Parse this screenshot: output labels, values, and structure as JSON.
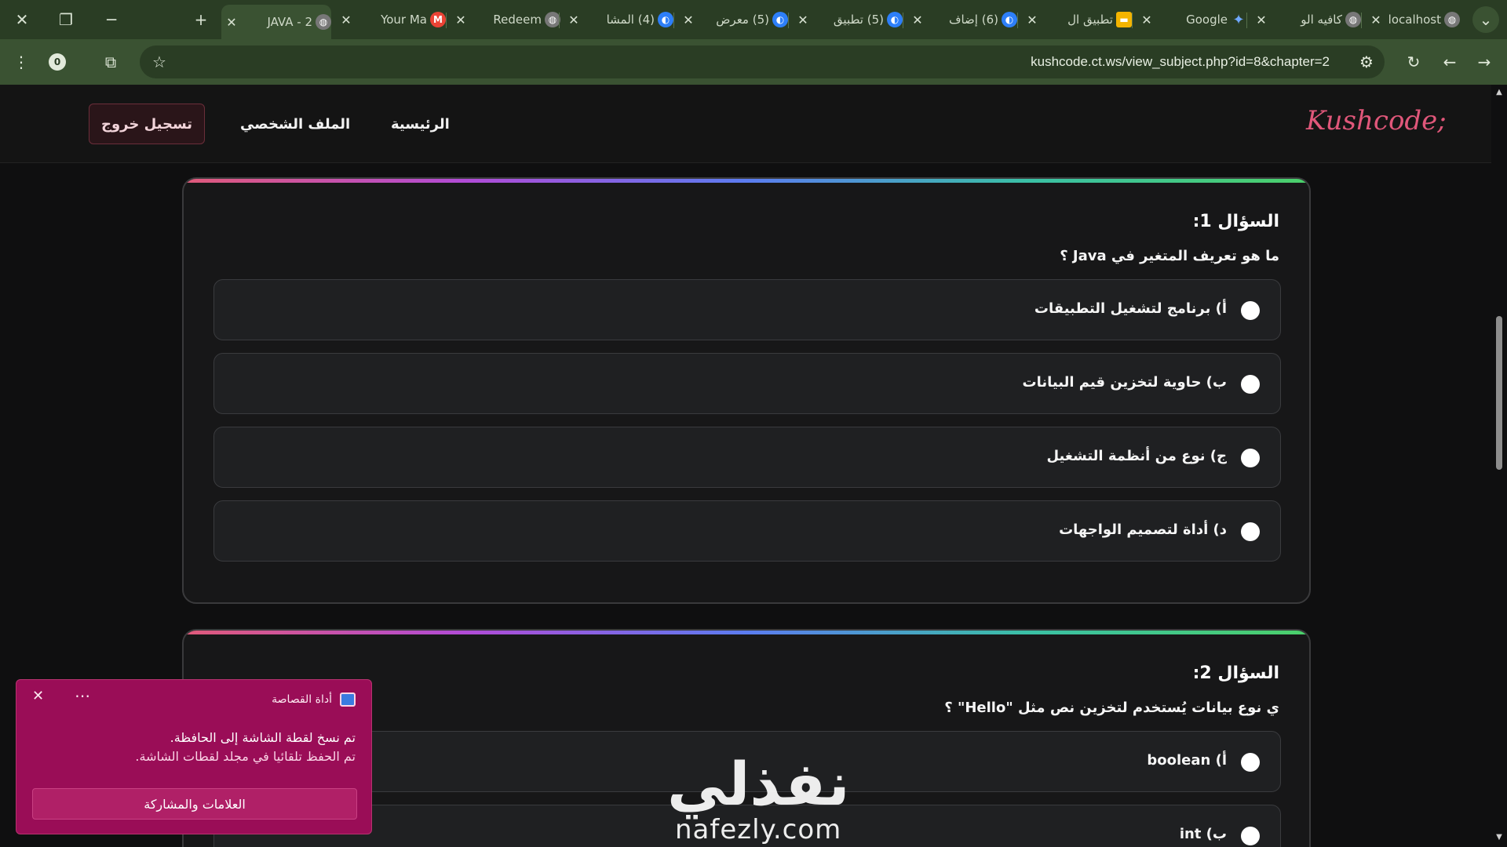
{
  "browser": {
    "tabs": [
      {
        "title": "localhost",
        "icon": "globe-icon"
      },
      {
        "title": "كافيه الو",
        "icon": "globe-icon"
      },
      {
        "title": "Google",
        "icon": "gemini-icon"
      },
      {
        "title": "تطبيق ال",
        "icon": "slides-icon"
      },
      {
        "title": "(6) إضاف",
        "icon": "app-icon"
      },
      {
        "title": "(5) تطبيق",
        "icon": "app-icon"
      },
      {
        "title": "(5) معرض",
        "icon": "app-icon"
      },
      {
        "title": "(4) المشا",
        "icon": "app-icon"
      },
      {
        "title": "Redeem",
        "icon": "globe-icon"
      },
      {
        "title": "Your Ma",
        "icon": "gmail-icon"
      },
      {
        "title": "JAVA - 2",
        "icon": "globe-icon",
        "active": true
      }
    ],
    "url": "kushcode.ct.ws/view_subject.php?id=8&chapter=2",
    "extension_badge": "0"
  },
  "site": {
    "logo": "Kushcode;",
    "nav": {
      "home": "الرئيسية",
      "profile": "الملف الشخصي",
      "logout": "تسجيل خروج"
    }
  },
  "questions": [
    {
      "title": "السؤال 1:",
      "text": "ما هو تعريف المتغير في Java ؟",
      "options": [
        "أ) برنامج لتشغيل التطبيقات",
        "ب) حاوية لتخزين قيم البيانات",
        "ج) نوع من أنظمة التشغيل",
        "د) أداة لتصميم الواجهات"
      ]
    },
    {
      "title": "السؤال 2:",
      "text": "ي نوع بيانات يُستخدم لتخزين نص مثل \"Hello\" ؟",
      "options": [
        "أ) boolean",
        "ب) int"
      ]
    }
  ],
  "toast": {
    "app_name": "أداة القصاصة",
    "line1": "تم نسخ لقطة الشاشة إلى الحافظة.",
    "line2": "تم الحفظ تلقائيا في مجلد لقطات الشاشة.",
    "button": "العلامات والمشاركة"
  },
  "watermark": {
    "arabic": "نفذلي",
    "latin": "nafezly.com"
  },
  "colors": {
    "tab_bar": "#2a3d24",
    "toolbar": "#3a5232",
    "logo": "#e0577a",
    "toast": "#9a0d57"
  }
}
